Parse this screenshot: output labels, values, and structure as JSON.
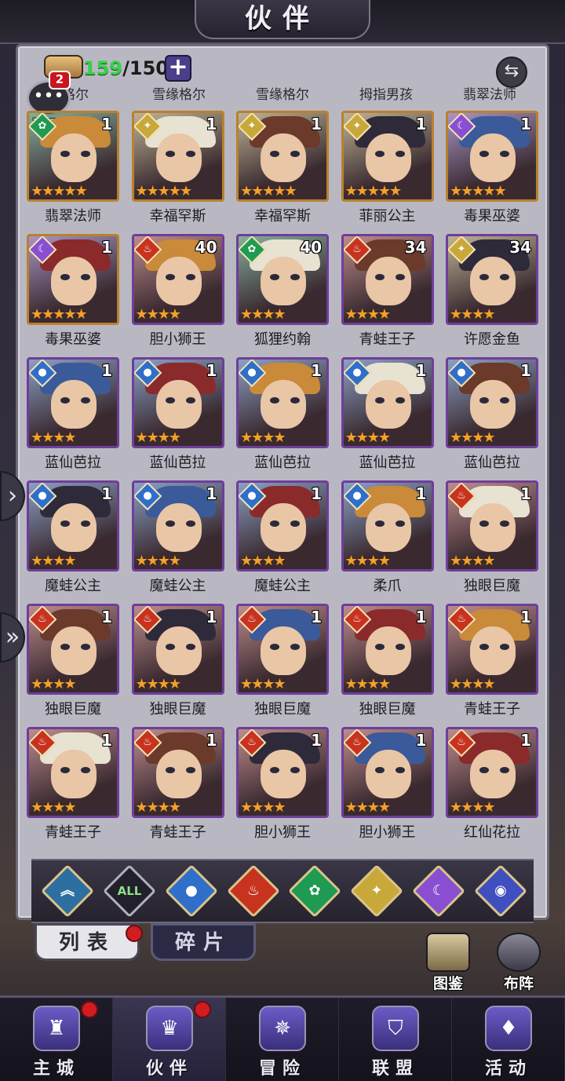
{
  "title": "伙伴",
  "header": {
    "current_count": "159",
    "max_count": "/150",
    "add_label": "+",
    "swap_label": "⇆"
  },
  "chat": {
    "label": "聊天",
    "badge": "2",
    "icon": "chat-bubble-icon"
  },
  "top_row_names": [
    "格尔",
    "雪缘格尔",
    "雪缘格尔",
    "拇指男孩",
    "翡翠法师"
  ],
  "partners": [
    {
      "name": "翡翠法师",
      "level": "1",
      "element": "wind",
      "stars": 5,
      "frame": "gold"
    },
    {
      "name": "幸福罕斯",
      "level": "1",
      "element": "light",
      "stars": 5,
      "frame": "gold"
    },
    {
      "name": "幸福罕斯",
      "level": "1",
      "element": "light",
      "stars": 5,
      "frame": "gold"
    },
    {
      "name": "菲丽公主",
      "level": "1",
      "element": "light",
      "stars": 5,
      "frame": "gold"
    },
    {
      "name": "毒果巫婆",
      "level": "1",
      "element": "dark",
      "stars": 5,
      "frame": "gold"
    },
    {
      "name": "毒果巫婆",
      "level": "1",
      "element": "dark",
      "stars": 5,
      "frame": "gold"
    },
    {
      "name": "胆小狮王",
      "level": "40",
      "element": "fire",
      "stars": 4,
      "frame": "purple"
    },
    {
      "name": "狐狸约翰",
      "level": "40",
      "element": "wind",
      "stars": 4,
      "frame": "purple"
    },
    {
      "name": "青蛙王子",
      "level": "34",
      "element": "fire",
      "stars": 4,
      "frame": "purple"
    },
    {
      "name": "许愿金鱼",
      "level": "34",
      "element": "light",
      "stars": 4,
      "frame": "purple"
    },
    {
      "name": "蓝仙芭拉",
      "level": "1",
      "element": "water",
      "stars": 4,
      "frame": "purple"
    },
    {
      "name": "蓝仙芭拉",
      "level": "1",
      "element": "water",
      "stars": 4,
      "frame": "purple"
    },
    {
      "name": "蓝仙芭拉",
      "level": "1",
      "element": "water",
      "stars": 4,
      "frame": "purple"
    },
    {
      "name": "蓝仙芭拉",
      "level": "1",
      "element": "water",
      "stars": 4,
      "frame": "purple"
    },
    {
      "name": "蓝仙芭拉",
      "level": "1",
      "element": "water",
      "stars": 4,
      "frame": "purple"
    },
    {
      "name": "魔蛙公主",
      "level": "1",
      "element": "water",
      "stars": 4,
      "frame": "purple"
    },
    {
      "name": "魔蛙公主",
      "level": "1",
      "element": "water",
      "stars": 4,
      "frame": "purple"
    },
    {
      "name": "魔蛙公主",
      "level": "1",
      "element": "water",
      "stars": 4,
      "frame": "purple"
    },
    {
      "name": "柔爪",
      "level": "1",
      "element": "water",
      "stars": 4,
      "frame": "purple"
    },
    {
      "name": "独眼巨魔",
      "level": "1",
      "element": "fire",
      "stars": 4,
      "frame": "purple"
    },
    {
      "name": "独眼巨魔",
      "level": "1",
      "element": "fire",
      "stars": 4,
      "frame": "purple"
    },
    {
      "name": "独眼巨魔",
      "level": "1",
      "element": "fire",
      "stars": 4,
      "frame": "purple"
    },
    {
      "name": "独眼巨魔",
      "level": "1",
      "element": "fire",
      "stars": 4,
      "frame": "purple"
    },
    {
      "name": "独眼巨魔",
      "level": "1",
      "element": "fire",
      "stars": 4,
      "frame": "purple"
    },
    {
      "name": "青蛙王子",
      "level": "1",
      "element": "fire",
      "stars": 4,
      "frame": "purple"
    },
    {
      "name": "青蛙王子",
      "level": "1",
      "element": "fire",
      "stars": 4,
      "frame": "purple"
    },
    {
      "name": "青蛙王子",
      "level": "1",
      "element": "fire",
      "stars": 4,
      "frame": "purple"
    },
    {
      "name": "胆小狮王",
      "level": "1",
      "element": "fire",
      "stars": 4,
      "frame": "purple"
    },
    {
      "name": "胆小狮王",
      "level": "1",
      "element": "fire",
      "stars": 4,
      "frame": "purple"
    },
    {
      "name": "红仙花拉",
      "level": "1",
      "element": "fire",
      "stars": 4,
      "frame": "purple"
    }
  ],
  "element_colors": {
    "fire": "#c7331f",
    "water": "#2f6fc9",
    "wind": "#1f9a52",
    "light": "#c9a83a",
    "dark": "#8a4fd0",
    "space": "#3f4fbf",
    "earth": "#2d6fa0"
  },
  "filters": [
    {
      "id": "earth",
      "label": "",
      "icon": "chevron-up-icon",
      "color": "#2d6fa0"
    },
    {
      "id": "all",
      "label": "ALL",
      "icon": "all-icon",
      "color": "#22202a"
    },
    {
      "id": "water",
      "label": "",
      "icon": "water-drop-icon",
      "color": "#2f6fc9"
    },
    {
      "id": "fire",
      "label": "",
      "icon": "flame-icon",
      "color": "#c7331f"
    },
    {
      "id": "wind",
      "label": "",
      "icon": "whirlwind-icon",
      "color": "#1f9a52"
    },
    {
      "id": "light",
      "label": "",
      "icon": "sun-star-icon",
      "color": "#c9a83a"
    },
    {
      "id": "dark",
      "label": "",
      "icon": "crescent-moon-icon",
      "color": "#8a4fd0"
    },
    {
      "id": "space",
      "label": "",
      "icon": "planet-icon",
      "color": "#3f4fbf"
    }
  ],
  "tabs": {
    "list": "列表",
    "fragments": "碎片"
  },
  "side_buttons": {
    "codex": "图鉴",
    "formation": "布阵"
  },
  "nav": [
    {
      "label": "主城",
      "icon": "castle-icon",
      "dot": true
    },
    {
      "label": "伙伴",
      "icon": "partner-hat-icon",
      "dot": true,
      "active": true
    },
    {
      "label": "冒险",
      "icon": "compass-icon",
      "dot": false
    },
    {
      "label": "联盟",
      "icon": "shield-icon",
      "dot": false
    },
    {
      "label": "活动",
      "icon": "cards-icon",
      "dot": false
    }
  ]
}
